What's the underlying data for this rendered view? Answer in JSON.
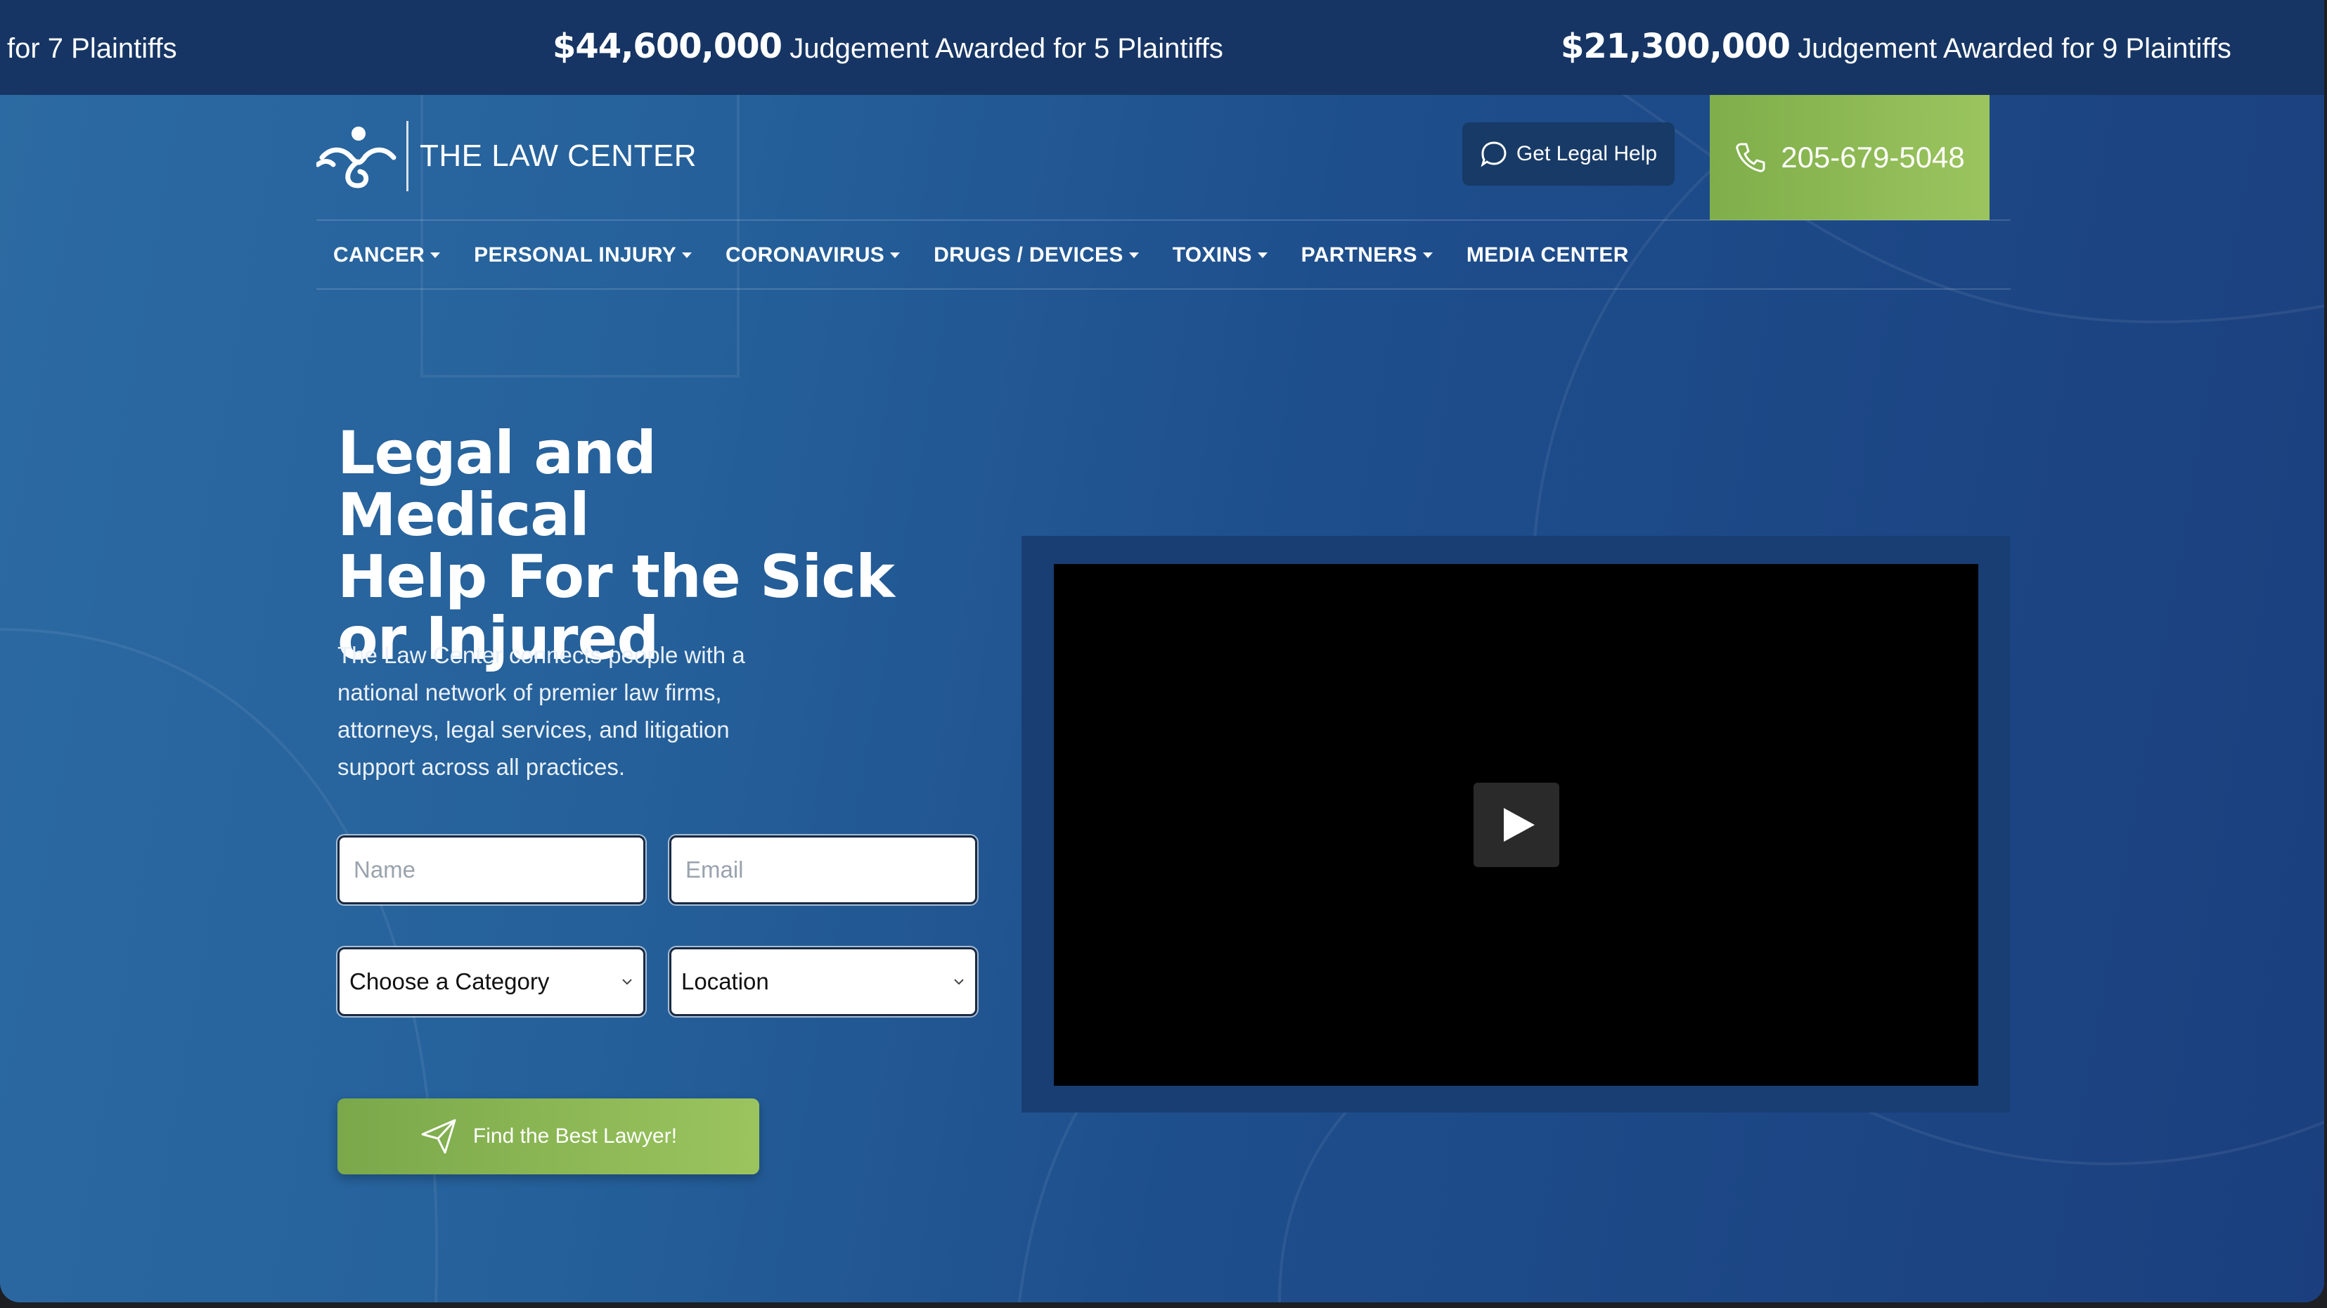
{
  "ticker": [
    {
      "amount": "",
      "text": "for 7 Plaintiffs"
    },
    {
      "amount": "$44,600,000",
      "text": "Judgement Awarded for 5 Plaintiffs"
    },
    {
      "amount": "$21,300,000",
      "text": "Judgement Awarded for 9 Plaintiffs"
    }
  ],
  "header": {
    "logo_text": "THE LAW CENTER",
    "legal_help_label": "Get Legal Help",
    "phone": "205-679-5048"
  },
  "nav": [
    {
      "label": "CANCER",
      "has_caret": true
    },
    {
      "label": "PERSONAL INJURY",
      "has_caret": true
    },
    {
      "label": "CORONAVIRUS",
      "has_caret": true
    },
    {
      "label": "DRUGS / DEVICES",
      "has_caret": true
    },
    {
      "label": "TOXINS",
      "has_caret": true
    },
    {
      "label": "PARTNERS",
      "has_caret": true
    },
    {
      "label": "MEDIA CENTER",
      "has_caret": false
    }
  ],
  "hero": {
    "headline_lines": [
      "Legal and Medical",
      "Help For the Sick",
      "or Injured"
    ],
    "intro_lines": [
      "The Law Center connects people with a",
      "national network of premier law firms,",
      "attorneys, legal services, and litigation",
      "support across all practices."
    ]
  },
  "form": {
    "name_placeholder": "Name",
    "email_placeholder": "Email",
    "category_value": "Choose a Category",
    "location_value": "Location",
    "submit_label": "Find the Best Lawyer!"
  },
  "colors": {
    "ticker_bg": "#163564",
    "accent_green": "#8bb653",
    "hero_blue": "#1e4e8c"
  },
  "icons": {
    "legal_help": "chat-bubble-icon",
    "phone": "phone-icon",
    "submit": "paper-plane-icon",
    "video": "play-icon"
  }
}
